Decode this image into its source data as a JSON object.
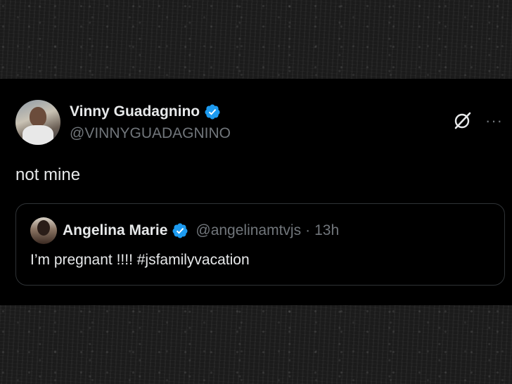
{
  "tweet": {
    "author": {
      "display_name": "Vinny Guadagnino",
      "handle": "@VINNYGUADAGNINO",
      "verified": true
    },
    "text": "not mine",
    "quoted_tweet": {
      "author": {
        "display_name": "Angelina Marie",
        "handle": "@angelinamtvjs",
        "verified": true
      },
      "separator": "·",
      "time": "13h",
      "text": "I’m pregnant !!!! #jsfamilyvacation"
    }
  },
  "icons": {
    "verified": "verified-badge-icon",
    "grok": "grok-icon",
    "more": "more-options-icon"
  },
  "colors": {
    "background": "#000000",
    "text_primary": "#e7e9ea",
    "text_secondary": "#71767b",
    "verified_blue": "#1d9bf0",
    "border": "#2f3336"
  }
}
